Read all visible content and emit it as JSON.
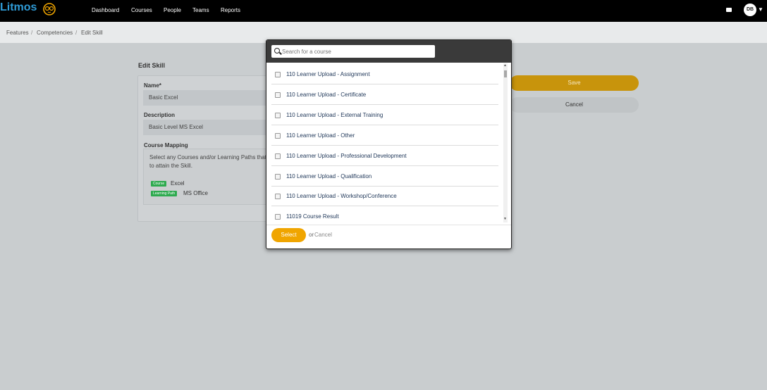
{
  "brand": {
    "name": "Litmos",
    "accent": "#2f9bd6"
  },
  "nav": {
    "items": [
      "Dashboard",
      "Courses",
      "People",
      "Teams",
      "Reports"
    ],
    "avatar_initials": "DB"
  },
  "breadcrumb": [
    "Features",
    "Competencies",
    "Edit Skill"
  ],
  "edit_skill": {
    "title": "Edit Skill",
    "name_label": "Name*",
    "name_value": "Basic Excel",
    "description_label": "Description",
    "description_value": "Basic Level MS Excel",
    "mapping_label": "Course Mapping",
    "mapping_help_1": "Select any Courses and/or Learning Paths that",
    "mapping_help_2": "to attain the Skill.",
    "mappings": [
      {
        "tag": "Course",
        "name": "Excel"
      },
      {
        "tag": "Learning Path",
        "name": "MS Office"
      }
    ]
  },
  "actions": {
    "save_label": "Save",
    "cancel_label": "Cancel",
    "accent": "#c8940c"
  },
  "modal": {
    "search_placeholder": "Search for a course",
    "courses": [
      "110 Learner Upload - Assignment",
      "110 Learner Upload - Certificate",
      "110 Learner Upload - External Training",
      "110 Learner Upload - Other",
      "110 Learner Upload - Professional Development",
      "110 Learner Upload - Qualification",
      "110 Learner Upload - Workshop/Conference",
      "11019 Course Result"
    ],
    "select_label": "Select",
    "or_label": "or",
    "cancel_label": "Cancel",
    "select_color": "#f0a500"
  }
}
